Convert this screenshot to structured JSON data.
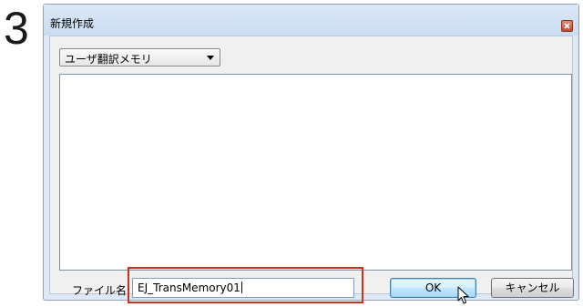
{
  "step": {
    "number": "3"
  },
  "dialog": {
    "title": "新規作成",
    "type_select": {
      "value": "ユーザ翻訳メモリ"
    },
    "filename": {
      "label": "ファイル名:",
      "value": "EJ_TransMemory01"
    },
    "buttons": {
      "ok": "OK",
      "cancel": "キャンセル"
    },
    "colors": {
      "highlight": "#c8321d",
      "close": "#c04a35"
    }
  },
  "icons": [
    "close-icon",
    "chevron-down-icon",
    "mouse-pointer-icon"
  ]
}
